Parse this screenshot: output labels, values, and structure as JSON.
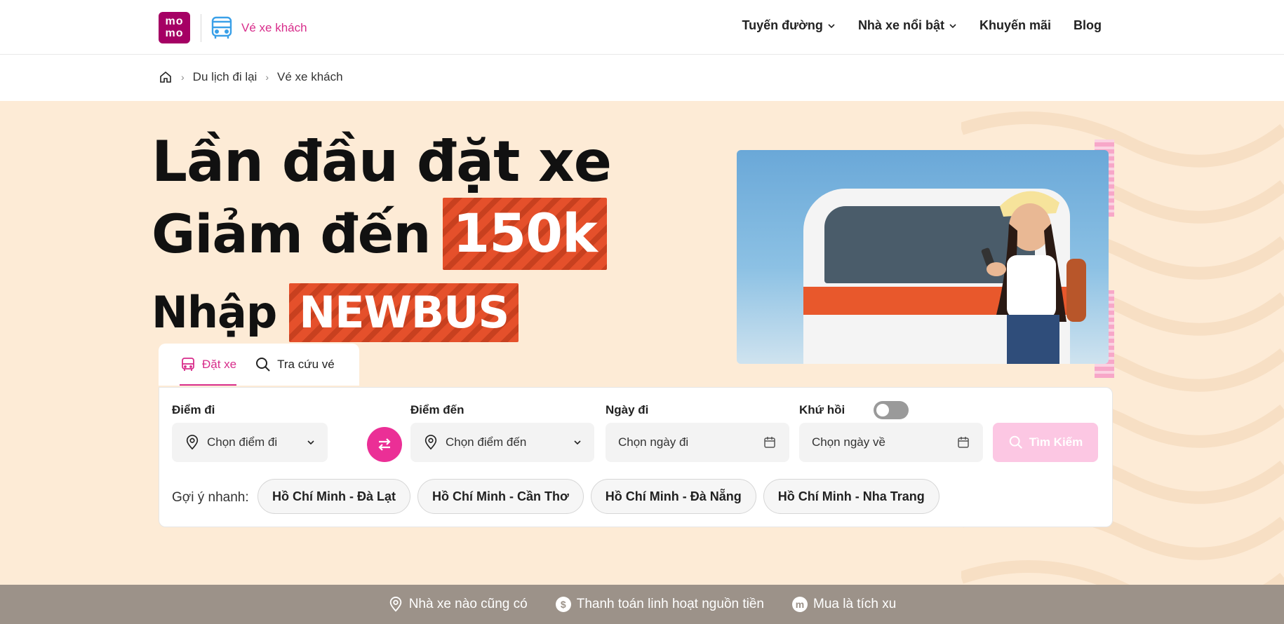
{
  "header": {
    "logo_text": "mo mo",
    "brand": "Vé xe khách",
    "nav": [
      {
        "label": "Tuyến đường",
        "has_dropdown": true
      },
      {
        "label": "Nhà xe nổi bật",
        "has_dropdown": true
      },
      {
        "label": "Khuyến mãi",
        "has_dropdown": false
      },
      {
        "label": "Blog",
        "has_dropdown": false
      }
    ]
  },
  "breadcrumb": {
    "home_icon": "home-icon",
    "items": [
      "Du lịch đi lại",
      "Vé xe khách"
    ]
  },
  "hero": {
    "line1": "Lần đầu đặt xe",
    "line2_prefix": "Giảm đến",
    "line2_highlight": "150k",
    "line3_prefix": "Nhập",
    "line3_highlight": "NEWBUS",
    "colors": {
      "background": "#fdebd6",
      "promo": "#e5502b",
      "accent": "#d82d8b"
    }
  },
  "tabs": [
    {
      "label": "Đặt xe",
      "icon": "bus-icon",
      "active": true
    },
    {
      "label": "Tra cứu vé",
      "icon": "search-icon",
      "active": false
    }
  ],
  "search": {
    "from": {
      "label": "Điểm đi",
      "placeholder": "Chọn điểm đi"
    },
    "to": {
      "label": "Điểm đến",
      "placeholder": "Chọn điểm đến"
    },
    "date": {
      "label": "Ngày đi",
      "placeholder": "Chọn ngày đi"
    },
    "return": {
      "label": "Khứ hồi",
      "placeholder": "Chọn ngày về",
      "enabled": false
    },
    "button": "Tìm Kiếm"
  },
  "suggestions": {
    "label": "Gợi ý nhanh:",
    "routes": [
      "Hồ Chí Minh - Đà Lạt",
      "Hồ Chí Minh - Cần Thơ",
      "Hồ Chí Minh - Đà Nẵng",
      "Hồ Chí Minh - Nha Trang"
    ]
  },
  "features": [
    {
      "icon": "location-pin-icon",
      "label": "Nhà xe nào cũng có"
    },
    {
      "icon": "dollar-icon",
      "label": "Thanh toán linh hoạt nguồn tiền"
    },
    {
      "icon": "momo-coin-icon",
      "label": "Mua là tích xu"
    }
  ]
}
